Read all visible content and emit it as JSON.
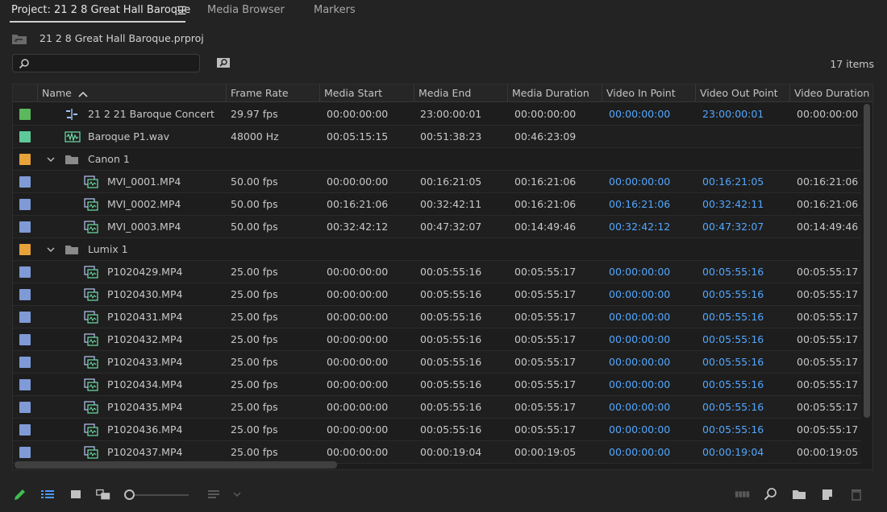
{
  "tabs": [
    {
      "label": "Project: 21 2 8 Great Hall Baroque",
      "active": true
    },
    {
      "label": "Media Browser",
      "active": false
    },
    {
      "label": "Markers",
      "active": false
    }
  ],
  "project": {
    "filename": "21 2 8 Great Hall Baroque.prproj"
  },
  "search": {
    "value": "",
    "placeholder": ""
  },
  "items_count": "17 items",
  "columns": [
    "Name",
    "Frame Rate",
    "Media Start",
    "Media End",
    "Media Duration",
    "Video In Point",
    "Video Out Point",
    "Video Duration"
  ],
  "colors": {
    "green": "#5bb85d",
    "mint": "#5ec99a",
    "orange": "#e8a23a",
    "blue": "#7f9ad6",
    "link": "#52a7ff"
  },
  "rows": [
    {
      "type": "sequence",
      "color": "#5bb85d",
      "name": "21 2 21 Baroque Concert",
      "frame_rate": "29.97 fps",
      "media_start": "00:00:00:00",
      "media_end": "23:00:00:01",
      "media_duration": "00:00:00:00",
      "video_in": "00:00:00:00",
      "video_out": "23:00:00:01",
      "video_duration": "00:00:00:00"
    },
    {
      "type": "audio",
      "color": "#5ec99a",
      "name": "Baroque P1.wav",
      "frame_rate": "48000 Hz",
      "media_start": "00:05:15:15",
      "media_end": "00:51:38:23",
      "media_duration": "00:46:23:09",
      "video_in": "",
      "video_out": "",
      "video_duration": ""
    },
    {
      "type": "folder",
      "color": "#e8a23a",
      "name": "Canon 1",
      "frame_rate": "",
      "media_start": "",
      "media_end": "",
      "media_duration": "",
      "video_in": "",
      "video_out": "",
      "video_duration": ""
    },
    {
      "type": "clip",
      "color": "#7f9ad6",
      "name": "MVI_0001.MP4",
      "frame_rate": "50.00 fps",
      "media_start": "00:00:00:00",
      "media_end": "00:16:21:05",
      "media_duration": "00:16:21:06",
      "video_in": "00:00:00:00",
      "video_out": "00:16:21:05",
      "video_duration": "00:16:21:06"
    },
    {
      "type": "clip",
      "color": "#7f9ad6",
      "name": "MVI_0002.MP4",
      "frame_rate": "50.00 fps",
      "media_start": "00:16:21:06",
      "media_end": "00:32:42:11",
      "media_duration": "00:16:21:06",
      "video_in": "00:16:21:06",
      "video_out": "00:32:42:11",
      "video_duration": "00:16:21:06"
    },
    {
      "type": "clip",
      "color": "#7f9ad6",
      "name": "MVI_0003.MP4",
      "frame_rate": "50.00 fps",
      "media_start": "00:32:42:12",
      "media_end": "00:47:32:07",
      "media_duration": "00:14:49:46",
      "video_in": "00:32:42:12",
      "video_out": "00:47:32:07",
      "video_duration": "00:14:49:46"
    },
    {
      "type": "folder",
      "color": "#e8a23a",
      "name": "Lumix 1",
      "frame_rate": "",
      "media_start": "",
      "media_end": "",
      "media_duration": "",
      "video_in": "",
      "video_out": "",
      "video_duration": ""
    },
    {
      "type": "clip",
      "color": "#7f9ad6",
      "name": "P1020429.MP4",
      "frame_rate": "25.00 fps",
      "media_start": "00:00:00:00",
      "media_end": "00:05:55:16",
      "media_duration": "00:05:55:17",
      "video_in": "00:00:00:00",
      "video_out": "00:05:55:16",
      "video_duration": "00:05:55:17"
    },
    {
      "type": "clip",
      "color": "#7f9ad6",
      "name": "P1020430.MP4",
      "frame_rate": "25.00 fps",
      "media_start": "00:00:00:00",
      "media_end": "00:05:55:16",
      "media_duration": "00:05:55:17",
      "video_in": "00:00:00:00",
      "video_out": "00:05:55:16",
      "video_duration": "00:05:55:17"
    },
    {
      "type": "clip",
      "color": "#7f9ad6",
      "name": "P1020431.MP4",
      "frame_rate": "25.00 fps",
      "media_start": "00:00:00:00",
      "media_end": "00:05:55:16",
      "media_duration": "00:05:55:17",
      "video_in": "00:00:00:00",
      "video_out": "00:05:55:16",
      "video_duration": "00:05:55:17"
    },
    {
      "type": "clip",
      "color": "#7f9ad6",
      "name": "P1020432.MP4",
      "frame_rate": "25.00 fps",
      "media_start": "00:00:00:00",
      "media_end": "00:05:55:16",
      "media_duration": "00:05:55:17",
      "video_in": "00:00:00:00",
      "video_out": "00:05:55:16",
      "video_duration": "00:05:55:17"
    },
    {
      "type": "clip",
      "color": "#7f9ad6",
      "name": "P1020433.MP4",
      "frame_rate": "25.00 fps",
      "media_start": "00:00:00:00",
      "media_end": "00:05:55:16",
      "media_duration": "00:05:55:17",
      "video_in": "00:00:00:00",
      "video_out": "00:05:55:16",
      "video_duration": "00:05:55:17"
    },
    {
      "type": "clip",
      "color": "#7f9ad6",
      "name": "P1020434.MP4",
      "frame_rate": "25.00 fps",
      "media_start": "00:00:00:00",
      "media_end": "00:05:55:16",
      "media_duration": "00:05:55:17",
      "video_in": "00:00:00:00",
      "video_out": "00:05:55:16",
      "video_duration": "00:05:55:17"
    },
    {
      "type": "clip",
      "color": "#7f9ad6",
      "name": "P1020435.MP4",
      "frame_rate": "25.00 fps",
      "media_start": "00:00:00:00",
      "media_end": "00:05:55:16",
      "media_duration": "00:05:55:17",
      "video_in": "00:00:00:00",
      "video_out": "00:05:55:16",
      "video_duration": "00:05:55:17"
    },
    {
      "type": "clip",
      "color": "#7f9ad6",
      "name": "P1020436.MP4",
      "frame_rate": "25.00 fps",
      "media_start": "00:00:00:00",
      "media_end": "00:05:55:16",
      "media_duration": "00:05:55:17",
      "video_in": "00:00:00:00",
      "video_out": "00:05:55:16",
      "video_duration": "00:05:55:17"
    },
    {
      "type": "clip",
      "color": "#7f9ad6",
      "name": "P1020437.MP4",
      "frame_rate": "25.00 fps",
      "media_start": "00:00:00:00",
      "media_end": "00:00:19:04",
      "media_duration": "00:00:19:05",
      "video_in": "00:00:00:00",
      "video_out": "00:00:19:04",
      "video_duration": "00:00:19:05"
    }
  ],
  "footer_icons": [
    "pencil-icon",
    "list-view-icon",
    "icon-view-icon",
    "freeform-view-icon",
    "zoom-slider",
    "sort-icons-icon",
    "automate-to-sequence-icon",
    "find-icon",
    "new-bin-icon",
    "new-item-icon",
    "trash-icon"
  ]
}
